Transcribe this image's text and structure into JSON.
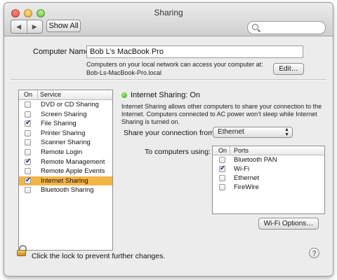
{
  "window": {
    "title": "Sharing"
  },
  "toolbar": {
    "back_glyph": "◀",
    "forward_glyph": "▶",
    "show_all_label": "Show All",
    "search_placeholder": ""
  },
  "computer_name": {
    "label": "Computer Name:",
    "value": "Bob L’s MacBook Pro",
    "info_line1": "Computers on your local network can access your computer at:",
    "info_line2": "Bob-Ls-MacBook-Pro.local",
    "edit_label": "Edit…"
  },
  "services": {
    "col_on": "On",
    "col_service": "Service",
    "items": [
      {
        "label": "DVD or CD Sharing",
        "checked": false,
        "selected": false
      },
      {
        "label": "Screen Sharing",
        "checked": false,
        "selected": false
      },
      {
        "label": "File Sharing",
        "checked": true,
        "selected": false
      },
      {
        "label": "Printer Sharing",
        "checked": false,
        "selected": false
      },
      {
        "label": "Scanner Sharing",
        "checked": false,
        "selected": false
      },
      {
        "label": "Remote Login",
        "checked": false,
        "selected": false
      },
      {
        "label": "Remote Management",
        "checked": true,
        "selected": false
      },
      {
        "label": "Remote Apple Events",
        "checked": false,
        "selected": false
      },
      {
        "label": "Internet Sharing",
        "checked": true,
        "selected": true
      },
      {
        "label": "Bluetooth Sharing",
        "checked": false,
        "selected": false
      }
    ]
  },
  "detail": {
    "status": "Internet Sharing: On",
    "status_color": "#3fb32a",
    "desc_line1": "Internet Sharing allows other computers to share your connection to the",
    "desc_line2": "Internet. Computers connected to AC power won’t sleep while Internet",
    "desc_line3": "Sharing is turned on.",
    "share_from_label": "Share your connection from:",
    "share_from_value": "Ethernet",
    "to_computers_label": "To computers using:",
    "ports_col_on": "On",
    "ports_col_ports": "Ports",
    "ports": [
      {
        "label": "Bluetooth PAN",
        "checked": false
      },
      {
        "label": "Wi-Fi",
        "checked": true
      },
      {
        "label": "Ethernet",
        "checked": false
      },
      {
        "label": "FireWire",
        "checked": false
      }
    ],
    "wifi_options_label": "Wi-Fi Options…"
  },
  "footer": {
    "lock_text": "Click the lock to prevent further changes.",
    "help_glyph": "?"
  },
  "colors": {
    "selection": "#f4b547",
    "window_bg": "#ececec"
  }
}
